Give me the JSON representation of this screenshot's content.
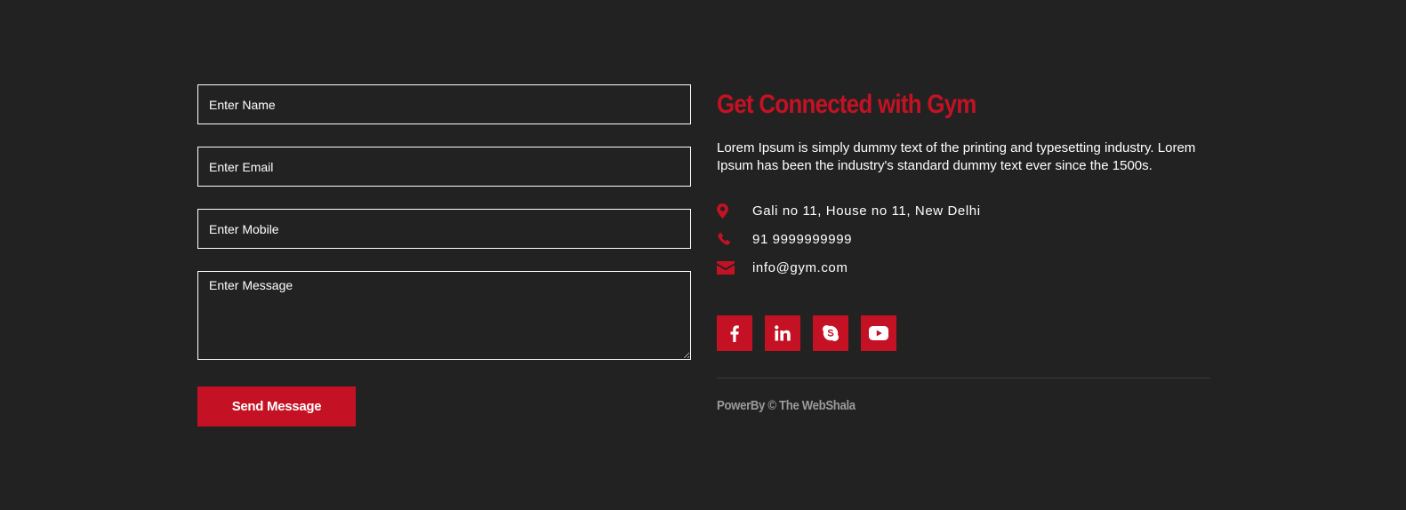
{
  "form": {
    "name_placeholder": "Enter Name",
    "email_placeholder": "Enter Email",
    "mobile_placeholder": "Enter Mobile",
    "message_placeholder": "Enter Message",
    "send_label": "Send Message"
  },
  "info": {
    "title": "Get Connected with Gym",
    "description": "Lorem Ipsum is simply dummy text of the printing and typesetting industry. Lorem Ipsum has been the industry's standard dummy text ever since the 1500s.",
    "contacts": [
      {
        "icon": "map-marker-icon",
        "text": "Gali no 11, House no 11, New Delhi"
      },
      {
        "icon": "phone-icon",
        "text": "91 9999999999"
      },
      {
        "icon": "envelope-icon",
        "text": "info@gym.com"
      }
    ],
    "social": [
      {
        "icon": "facebook-icon"
      },
      {
        "icon": "linkedin-icon"
      },
      {
        "icon": "skype-icon"
      },
      {
        "icon": "youtube-icon"
      }
    ],
    "footer": "PowerBy © The WebShala"
  },
  "colors": {
    "background": "#222222",
    "accent": "#c41224",
    "text": "#ffffff",
    "muted": "#9a9a9a"
  }
}
